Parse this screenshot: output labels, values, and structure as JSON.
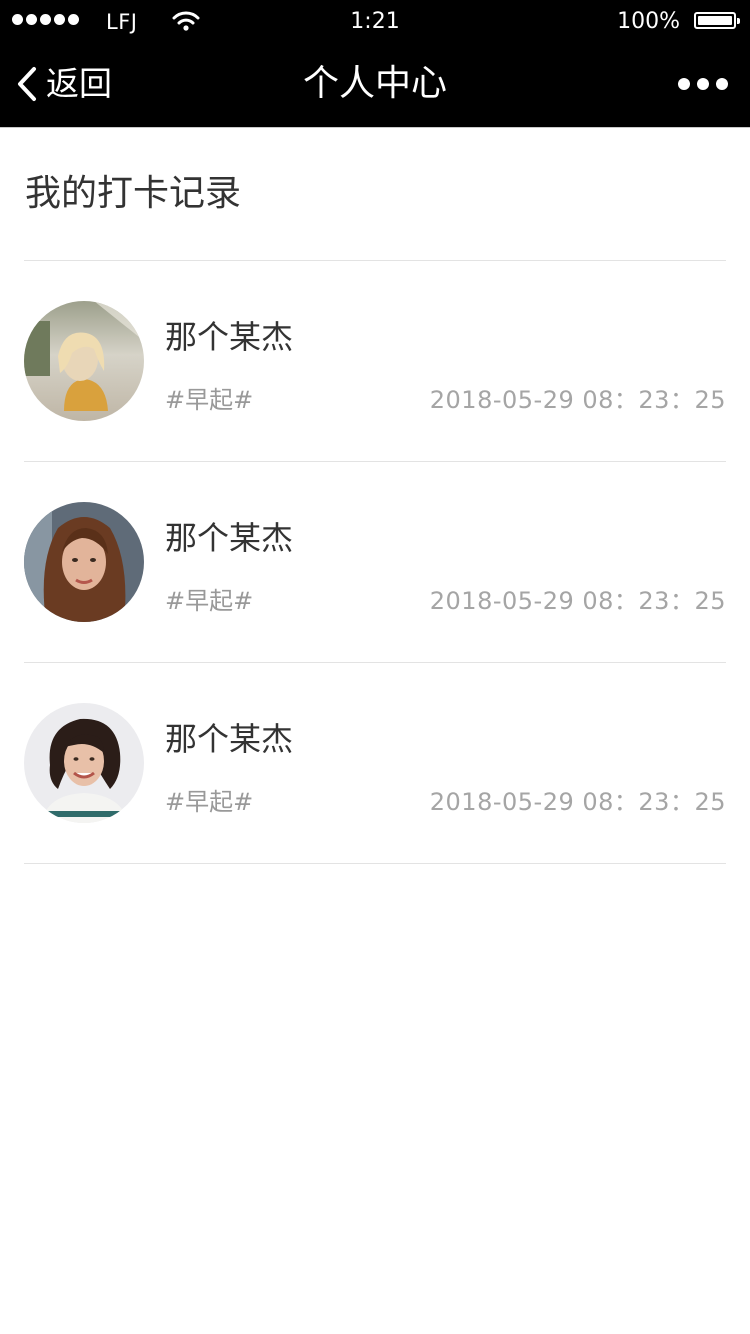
{
  "status_bar": {
    "carrier": "LFJ",
    "time": "1:21",
    "battery": "100%"
  },
  "nav": {
    "back_label": "返回",
    "title": "个人中心"
  },
  "section_title": "我的打卡记录",
  "records": [
    {
      "name": "那个某杰",
      "tag": "#早起#",
      "time": "2018-05-29 08：23：25"
    },
    {
      "name": "那个某杰",
      "tag": "#早起#",
      "time": "2018-05-29 08：23：25"
    },
    {
      "name": "那个某杰",
      "tag": "#早起#",
      "time": "2018-05-29 08：23：25"
    }
  ]
}
